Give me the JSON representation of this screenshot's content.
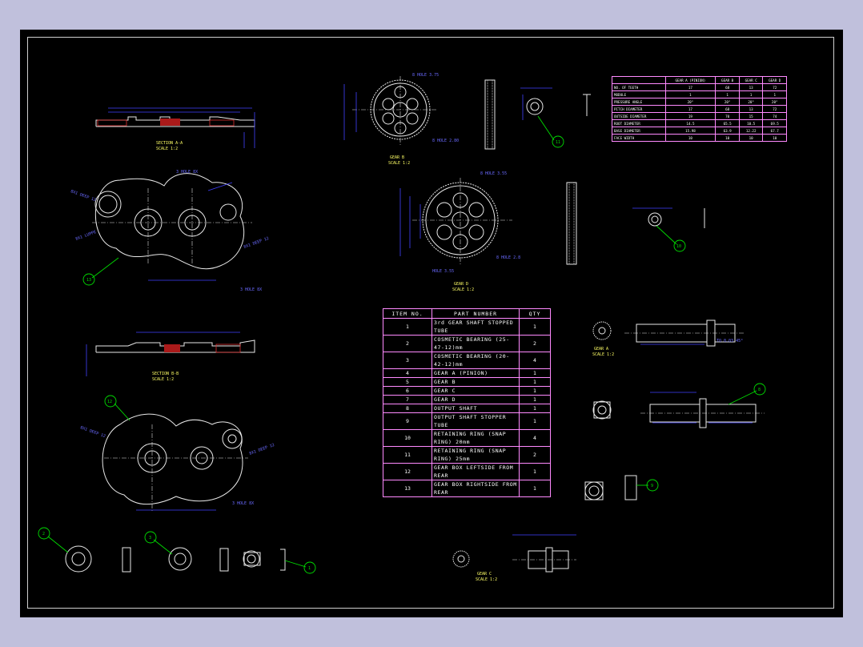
{
  "drawing": {
    "section_aa": {
      "title": "SECTION A-A",
      "scale": "SCALE 1:2"
    },
    "section_bb": {
      "title": "SECTION B-B",
      "scale": "SCALE 1:2"
    },
    "gear_b": {
      "title": "GEAR B",
      "scale": "SCALE 1:2"
    },
    "gear_d": {
      "title": "GEAR D",
      "scale": "SCALE 1:2"
    },
    "gear_a": {
      "title": "GEAR A",
      "scale": "SCALE 1:2"
    },
    "gear_c": {
      "title": "GEAR C",
      "scale": "SCALE 1:2"
    }
  },
  "parts_table": {
    "headers": [
      "ITEM NO.",
      "PART NUMBER",
      "QTY"
    ],
    "rows": [
      {
        "item": "1",
        "part": "3rd GEAR SHAFT STOPPED TUBE",
        "qty": "1"
      },
      {
        "item": "2",
        "part": "COSMETIC BEARING (25-47-12)mm",
        "qty": "2"
      },
      {
        "item": "3",
        "part": "COSMETIC BEARING (20-42-12)mm",
        "qty": "4"
      },
      {
        "item": "4",
        "part": "GEAR A (PINION)",
        "qty": "1"
      },
      {
        "item": "5",
        "part": "GEAR B",
        "qty": "1"
      },
      {
        "item": "6",
        "part": "GEAR C",
        "qty": "1"
      },
      {
        "item": "7",
        "part": "GEAR D",
        "qty": "1"
      },
      {
        "item": "8",
        "part": "OUTPUT SHAFT",
        "qty": "1"
      },
      {
        "item": "9",
        "part": "OUTPUT SHAFT STOPPER TUBE",
        "qty": "1"
      },
      {
        "item": "10",
        "part": "RETAINING RING (SNAP RING) 20mm",
        "qty": "4"
      },
      {
        "item": "11",
        "part": "RETAINING RING (SNAP RING) 25mm",
        "qty": "2"
      },
      {
        "item": "12",
        "part": "GEAR BOX LEFTSIDE FROM REAR",
        "qty": "1"
      },
      {
        "item": "13",
        "part": "GEAR BOX RIGHTSIDE FROM REAR",
        "qty": "1"
      }
    ]
  },
  "gear_table": {
    "headers": [
      "",
      "GEAR A (PINION)",
      "GEAR B",
      "GEAR C",
      "GEAR D"
    ],
    "rows": [
      [
        "NO. OF TEETH",
        "17",
        "68",
        "13",
        "72"
      ],
      [
        "MODULE",
        "1",
        "1",
        "1",
        "1"
      ],
      [
        "PRESSURE ANGLE",
        "20°",
        "20°",
        "20°",
        "20°"
      ],
      [
        "PITCH DIAMETER",
        "17",
        "68",
        "13",
        "72"
      ],
      [
        "OUTSIDE DIAMETER",
        "19",
        "70",
        "15",
        "74"
      ],
      [
        "ROOT DIAMETER",
        "14.5",
        "65.5",
        "10.5",
        "69.5"
      ],
      [
        "BASE DIAMETER",
        "15.98",
        "63.9",
        "12.22",
        "67.7"
      ],
      [
        "FACE WIDTH",
        "10",
        "10",
        "10",
        "10"
      ]
    ]
  },
  "balloons": [
    "13",
    "12",
    "11",
    "10",
    "8",
    "9",
    "2",
    "3",
    "1"
  ]
}
